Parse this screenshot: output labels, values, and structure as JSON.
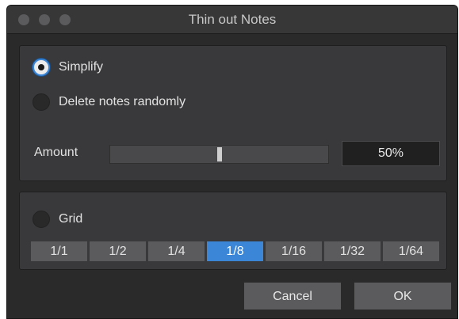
{
  "window": {
    "title": "Thin out Notes"
  },
  "modes": [
    {
      "label": "Simplify",
      "selected": true
    },
    {
      "label": "Delete notes randomly",
      "selected": false
    }
  ],
  "amount": {
    "label": "Amount",
    "value": "50%",
    "fraction": 0.5
  },
  "grid": {
    "label": "Grid",
    "selected": false,
    "options": [
      "1/1",
      "1/2",
      "1/4",
      "1/8",
      "1/16",
      "1/32",
      "1/64"
    ],
    "active": "1/8"
  },
  "buttons": {
    "cancel": "Cancel",
    "ok": "OK"
  },
  "colors": {
    "accent": "#3b86d6",
    "panel": "#39393b",
    "background": "#2a2a2b"
  }
}
